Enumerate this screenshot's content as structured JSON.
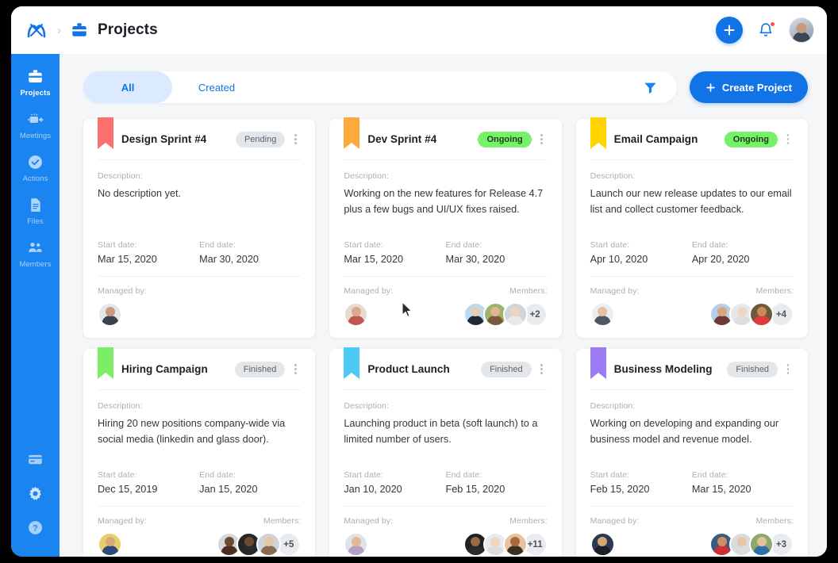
{
  "window": {
    "background": "#f4f6f8",
    "accent": "#1273e6"
  },
  "topbar": {
    "logo_icon": "brand-logo-icon",
    "breadcrumb_separator": "›",
    "section_icon": "briefcase-icon",
    "title": "Projects",
    "add_button_label": "+",
    "notifications_icon": "bell-icon",
    "avatar_label": "user-avatar"
  },
  "sidebar": {
    "items": [
      {
        "label": "Projects",
        "icon": "briefcase-icon",
        "active": true
      },
      {
        "label": "Meetings",
        "icon": "video-camera-icon",
        "active": false
      },
      {
        "label": "Actions",
        "icon": "check-circle-icon",
        "active": false
      },
      {
        "label": "Files",
        "icon": "document-icon",
        "active": false
      },
      {
        "label": "Members",
        "icon": "people-icon",
        "active": false
      }
    ],
    "bottom_items": [
      {
        "label": "Billing",
        "icon": "card-icon"
      },
      {
        "label": "Settings",
        "icon": "gear-icon"
      },
      {
        "label": "Help",
        "icon": "question-circle-icon"
      }
    ]
  },
  "toolbar": {
    "tabs": [
      {
        "label": "All",
        "active": true
      },
      {
        "label": "Created",
        "active": false
      }
    ],
    "filter_icon": "funnel-icon",
    "create_button_label": "Create Project",
    "create_button_icon": "plus-icon"
  },
  "labels": {
    "description": "Description:",
    "start_date": "Start date:",
    "end_date": "End date:",
    "managed_by": "Managed by:",
    "members": "Members:"
  },
  "projects": [
    {
      "title": "Design Sprint #4",
      "ribbon_color": "#fb6f6f",
      "status": "Pending",
      "status_kind": "pending",
      "description": "No description yet.",
      "start_date": "Mar 15, 2020",
      "end_date": "Mar 30, 2020",
      "manager_avatar": {
        "skin": "#c79a7d",
        "shirt": "#3a4250",
        "bg": "#e3e7ec"
      },
      "members": [],
      "members_more": null
    },
    {
      "title": "Dev Sprint #4",
      "ribbon_color": "#fcaa3c",
      "status": "Ongoing",
      "status_kind": "ongoing",
      "description": "Working on the new features for Release 4.7 plus a few bugs and UI/UX fixes raised.",
      "start_date": "Mar 15, 2020",
      "end_date": "Mar 30, 2020",
      "manager_avatar": {
        "skin": "#dca98d",
        "shirt": "#c0584f",
        "bg": "#e9d9cf"
      },
      "members": [
        {
          "skin": "#e8cdb5",
          "shirt": "#1f2a36",
          "bg": "#bcd9ef"
        },
        {
          "skin": "#e3b493",
          "shirt": "#7d5a3c",
          "bg": "#9db46b"
        },
        {
          "skin": "#efd3bd",
          "shirt": "#e8e8e8",
          "bg": "#cfd5dc"
        }
      ],
      "members_more": "+2"
    },
    {
      "title": "Email Campaign",
      "ribbon_color": "#ffd400",
      "status": "Ongoing",
      "status_kind": "ongoing",
      "description": "Launch our new release updates to our email list and collect customer feedback.",
      "start_date": "Apr 10, 2020",
      "end_date": "Apr 20, 2020",
      "manager_avatar": {
        "skin": "#e7c0a4",
        "shirt": "#4f5763",
        "bg": "#eceff2"
      },
      "members": [
        {
          "skin": "#d8a57e",
          "shirt": "#6d3a35",
          "bg": "#b7cfe4"
        },
        {
          "skin": "#f0d7c4",
          "shirt": "#dedede",
          "bg": "#e6e9ec"
        },
        {
          "skin": "#c98a5c",
          "shirt": "#e03b3b",
          "bg": "#6e5a3a"
        }
      ],
      "members_more": "+4"
    },
    {
      "title": "Hiring Campaign",
      "ribbon_color": "#7ded67",
      "status": "Finished",
      "status_kind": "finished",
      "description": "Hiring 20 new positions company-wide via social media (linkedin and glass door).",
      "start_date": "Dec 15, 2019",
      "end_date": "Jan 15, 2020",
      "manager_avatar": {
        "skin": "#dba878",
        "shirt": "#2d4a7a",
        "bg": "#e5d06a"
      },
      "members": [
        {
          "skin": "#6b4a33",
          "shirt": "#4a3020",
          "bg": "#d5d7da"
        },
        {
          "skin": "#6d4a34",
          "shirt": "#2a2a2a",
          "bg": "#262626"
        },
        {
          "skin": "#e7c6a8",
          "shirt": "#8a6a4e",
          "bg": "#cfd3d7"
        }
      ],
      "members_more": "+5"
    },
    {
      "title": "Product Launch",
      "ribbon_color": "#4cc9f5",
      "status": "Finished",
      "status_kind": "finished",
      "description": "Launching product in beta (soft launch) to a limited number of users.",
      "start_date": "Jan 10, 2020",
      "end_date": "Feb 15, 2020",
      "manager_avatar": {
        "skin": "#e2b896",
        "shirt": "#b8a0c4",
        "bg": "#dfe3e8"
      },
      "members": [
        {
          "skin": "#9a6a45",
          "shirt": "#2b2b2b",
          "bg": "#1e2126"
        },
        {
          "skin": "#f0d6c2",
          "shirt": "#dcdcdc",
          "bg": "#e8ebee"
        },
        {
          "skin": "#a9693f",
          "shirt": "#3a3026",
          "bg": "#e8c29a"
        }
      ],
      "members_more": "+11"
    },
    {
      "title": "Business Modeling",
      "ribbon_color": "#9d7bf5",
      "status": "Finished",
      "status_kind": "finished",
      "description": "Working on developing and expanding our business model and revenue model.",
      "start_date": "Feb 15, 2020",
      "end_date": "Mar 15, 2020",
      "manager_avatar": {
        "skin": "#d8a478",
        "shirt": "#1d2026",
        "bg": "#2a3a52"
      },
      "members": [
        {
          "skin": "#cf8f62",
          "shirt": "#d03030",
          "bg": "#3a5a86"
        },
        {
          "skin": "#e8c5a5",
          "shirt": "#dcdcdc",
          "bg": "#d8dbde"
        },
        {
          "skin": "#e4c29c",
          "shirt": "#2f6fa8",
          "bg": "#8fa86e"
        }
      ],
      "members_more": "+3"
    }
  ]
}
